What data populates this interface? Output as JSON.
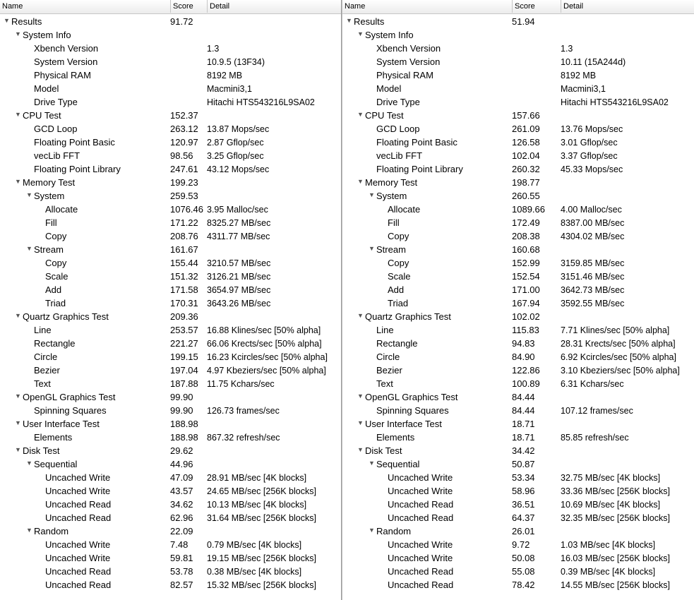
{
  "header": {
    "name": "Name",
    "score": "Score",
    "detail": "Detail"
  },
  "panels": [
    {
      "rows": [
        {
          "level": 0,
          "expander": true,
          "name": "Results",
          "score": "91.72",
          "detail": ""
        },
        {
          "level": 1,
          "expander": true,
          "name": "System Info",
          "score": "",
          "detail": ""
        },
        {
          "level": 2,
          "expander": false,
          "name": "Xbench Version",
          "score": "",
          "detail": "1.3"
        },
        {
          "level": 2,
          "expander": false,
          "name": "System Version",
          "score": "",
          "detail": "10.9.5 (13F34)"
        },
        {
          "level": 2,
          "expander": false,
          "name": "Physical RAM",
          "score": "",
          "detail": "8192 MB"
        },
        {
          "level": 2,
          "expander": false,
          "name": "Model",
          "score": "",
          "detail": "Macmini3,1"
        },
        {
          "level": 2,
          "expander": false,
          "name": "Drive Type",
          "score": "",
          "detail": "Hitachi HTS543216L9SA02"
        },
        {
          "level": 1,
          "expander": true,
          "name": "CPU Test",
          "score": "152.37",
          "detail": ""
        },
        {
          "level": 2,
          "expander": false,
          "name": "GCD Loop",
          "score": "263.12",
          "detail": "13.87 Mops/sec"
        },
        {
          "level": 2,
          "expander": false,
          "name": "Floating Point Basic",
          "score": "120.97",
          "detail": "2.87 Gflop/sec"
        },
        {
          "level": 2,
          "expander": false,
          "name": "vecLib FFT",
          "score": "98.56",
          "detail": "3.25 Gflop/sec"
        },
        {
          "level": 2,
          "expander": false,
          "name": "Floating Point Library",
          "score": "247.61",
          "detail": "43.12 Mops/sec"
        },
        {
          "level": 1,
          "expander": true,
          "name": "Memory Test",
          "score": "199.23",
          "detail": ""
        },
        {
          "level": 2,
          "expander": true,
          "name": "System",
          "score": "259.53",
          "detail": ""
        },
        {
          "level": 3,
          "expander": false,
          "name": "Allocate",
          "score": "1076.46",
          "detail": "3.95 Malloc/sec"
        },
        {
          "level": 3,
          "expander": false,
          "name": "Fill",
          "score": "171.22",
          "detail": "8325.27 MB/sec"
        },
        {
          "level": 3,
          "expander": false,
          "name": "Copy",
          "score": "208.76",
          "detail": "4311.77 MB/sec"
        },
        {
          "level": 2,
          "expander": true,
          "name": "Stream",
          "score": "161.67",
          "detail": ""
        },
        {
          "level": 3,
          "expander": false,
          "name": "Copy",
          "score": "155.44",
          "detail": "3210.57 MB/sec"
        },
        {
          "level": 3,
          "expander": false,
          "name": "Scale",
          "score": "151.32",
          "detail": "3126.21 MB/sec"
        },
        {
          "level": 3,
          "expander": false,
          "name": "Add",
          "score": "171.58",
          "detail": "3654.97 MB/sec"
        },
        {
          "level": 3,
          "expander": false,
          "name": "Triad",
          "score": "170.31",
          "detail": "3643.26 MB/sec"
        },
        {
          "level": 1,
          "expander": true,
          "name": "Quartz Graphics Test",
          "score": "209.36",
          "detail": ""
        },
        {
          "level": 2,
          "expander": false,
          "name": "Line",
          "score": "253.57",
          "detail": "16.88 Klines/sec [50% alpha]"
        },
        {
          "level": 2,
          "expander": false,
          "name": "Rectangle",
          "score": "221.27",
          "detail": "66.06 Krects/sec [50% alpha]"
        },
        {
          "level": 2,
          "expander": false,
          "name": "Circle",
          "score": "199.15",
          "detail": "16.23 Kcircles/sec [50% alpha]"
        },
        {
          "level": 2,
          "expander": false,
          "name": "Bezier",
          "score": "197.04",
          "detail": "4.97 Kbeziers/sec [50% alpha]"
        },
        {
          "level": 2,
          "expander": false,
          "name": "Text",
          "score": "187.88",
          "detail": "11.75 Kchars/sec"
        },
        {
          "level": 1,
          "expander": true,
          "name": "OpenGL Graphics Test",
          "score": "99.90",
          "detail": ""
        },
        {
          "level": 2,
          "expander": false,
          "name": "Spinning Squares",
          "score": "99.90",
          "detail": "126.73 frames/sec"
        },
        {
          "level": 1,
          "expander": true,
          "name": "User Interface Test",
          "score": "188.98",
          "detail": ""
        },
        {
          "level": 2,
          "expander": false,
          "name": "Elements",
          "score": "188.98",
          "detail": "867.32 refresh/sec"
        },
        {
          "level": 1,
          "expander": true,
          "name": "Disk Test",
          "score": "29.62",
          "detail": ""
        },
        {
          "level": 2,
          "expander": true,
          "name": "Sequential",
          "score": "44.96",
          "detail": ""
        },
        {
          "level": 3,
          "expander": false,
          "name": "Uncached Write",
          "score": "47.09",
          "detail": "28.91 MB/sec [4K blocks]"
        },
        {
          "level": 3,
          "expander": false,
          "name": "Uncached Write",
          "score": "43.57",
          "detail": "24.65 MB/sec [256K blocks]"
        },
        {
          "level": 3,
          "expander": false,
          "name": "Uncached Read",
          "score": "34.62",
          "detail": "10.13 MB/sec [4K blocks]"
        },
        {
          "level": 3,
          "expander": false,
          "name": "Uncached Read",
          "score": "62.96",
          "detail": "31.64 MB/sec [256K blocks]"
        },
        {
          "level": 2,
          "expander": true,
          "name": "Random",
          "score": "22.09",
          "detail": ""
        },
        {
          "level": 3,
          "expander": false,
          "name": "Uncached Write",
          "score": "7.48",
          "detail": "0.79 MB/sec [4K blocks]"
        },
        {
          "level": 3,
          "expander": false,
          "name": "Uncached Write",
          "score": "59.81",
          "detail": "19.15 MB/sec [256K blocks]"
        },
        {
          "level": 3,
          "expander": false,
          "name": "Uncached Read",
          "score": "53.78",
          "detail": "0.38 MB/sec [4K blocks]"
        },
        {
          "level": 3,
          "expander": false,
          "name": "Uncached Read",
          "score": "82.57",
          "detail": "15.32 MB/sec [256K blocks]"
        }
      ]
    },
    {
      "rows": [
        {
          "level": 0,
          "expander": true,
          "name": "Results",
          "score": "51.94",
          "detail": ""
        },
        {
          "level": 1,
          "expander": true,
          "name": "System Info",
          "score": "",
          "detail": ""
        },
        {
          "level": 2,
          "expander": false,
          "name": "Xbench Version",
          "score": "",
          "detail": "1.3"
        },
        {
          "level": 2,
          "expander": false,
          "name": "System Version",
          "score": "",
          "detail": "10.11 (15A244d)"
        },
        {
          "level": 2,
          "expander": false,
          "name": "Physical RAM",
          "score": "",
          "detail": "8192 MB"
        },
        {
          "level": 2,
          "expander": false,
          "name": "Model",
          "score": "",
          "detail": "Macmini3,1"
        },
        {
          "level": 2,
          "expander": false,
          "name": "Drive Type",
          "score": "",
          "detail": "Hitachi HTS543216L9SA02"
        },
        {
          "level": 1,
          "expander": true,
          "name": "CPU Test",
          "score": "157.66",
          "detail": ""
        },
        {
          "level": 2,
          "expander": false,
          "name": "GCD Loop",
          "score": "261.09",
          "detail": "13.76 Mops/sec"
        },
        {
          "level": 2,
          "expander": false,
          "name": "Floating Point Basic",
          "score": "126.58",
          "detail": "3.01 Gflop/sec"
        },
        {
          "level": 2,
          "expander": false,
          "name": "vecLib FFT",
          "score": "102.04",
          "detail": "3.37 Gflop/sec"
        },
        {
          "level": 2,
          "expander": false,
          "name": "Floating Point Library",
          "score": "260.32",
          "detail": "45.33 Mops/sec"
        },
        {
          "level": 1,
          "expander": true,
          "name": "Memory Test",
          "score": "198.77",
          "detail": ""
        },
        {
          "level": 2,
          "expander": true,
          "name": "System",
          "score": "260.55",
          "detail": ""
        },
        {
          "level": 3,
          "expander": false,
          "name": "Allocate",
          "score": "1089.66",
          "detail": "4.00 Malloc/sec"
        },
        {
          "level": 3,
          "expander": false,
          "name": "Fill",
          "score": "172.49",
          "detail": "8387.00 MB/sec"
        },
        {
          "level": 3,
          "expander": false,
          "name": "Copy",
          "score": "208.38",
          "detail": "4304.02 MB/sec"
        },
        {
          "level": 2,
          "expander": true,
          "name": "Stream",
          "score": "160.68",
          "detail": ""
        },
        {
          "level": 3,
          "expander": false,
          "name": "Copy",
          "score": "152.99",
          "detail": "3159.85 MB/sec"
        },
        {
          "level": 3,
          "expander": false,
          "name": "Scale",
          "score": "152.54",
          "detail": "3151.46 MB/sec"
        },
        {
          "level": 3,
          "expander": false,
          "name": "Add",
          "score": "171.00",
          "detail": "3642.73 MB/sec"
        },
        {
          "level": 3,
          "expander": false,
          "name": "Triad",
          "score": "167.94",
          "detail": "3592.55 MB/sec"
        },
        {
          "level": 1,
          "expander": true,
          "name": "Quartz Graphics Test",
          "score": "102.02",
          "detail": ""
        },
        {
          "level": 2,
          "expander": false,
          "name": "Line",
          "score": "115.83",
          "detail": "7.71 Klines/sec [50% alpha]"
        },
        {
          "level": 2,
          "expander": false,
          "name": "Rectangle",
          "score": "94.83",
          "detail": "28.31 Krects/sec [50% alpha]"
        },
        {
          "level": 2,
          "expander": false,
          "name": "Circle",
          "score": "84.90",
          "detail": "6.92 Kcircles/sec [50% alpha]"
        },
        {
          "level": 2,
          "expander": false,
          "name": "Bezier",
          "score": "122.86",
          "detail": "3.10 Kbeziers/sec [50% alpha]"
        },
        {
          "level": 2,
          "expander": false,
          "name": "Text",
          "score": "100.89",
          "detail": "6.31 Kchars/sec"
        },
        {
          "level": 1,
          "expander": true,
          "name": "OpenGL Graphics Test",
          "score": "84.44",
          "detail": ""
        },
        {
          "level": 2,
          "expander": false,
          "name": "Spinning Squares",
          "score": "84.44",
          "detail": "107.12 frames/sec"
        },
        {
          "level": 1,
          "expander": true,
          "name": "User Interface Test",
          "score": "18.71",
          "detail": ""
        },
        {
          "level": 2,
          "expander": false,
          "name": "Elements",
          "score": "18.71",
          "detail": "85.85 refresh/sec"
        },
        {
          "level": 1,
          "expander": true,
          "name": "Disk Test",
          "score": "34.42",
          "detail": ""
        },
        {
          "level": 2,
          "expander": true,
          "name": "Sequential",
          "score": "50.87",
          "detail": ""
        },
        {
          "level": 3,
          "expander": false,
          "name": "Uncached Write",
          "score": "53.34",
          "detail": "32.75 MB/sec [4K blocks]"
        },
        {
          "level": 3,
          "expander": false,
          "name": "Uncached Write",
          "score": "58.96",
          "detail": "33.36 MB/sec [256K blocks]"
        },
        {
          "level": 3,
          "expander": false,
          "name": "Uncached Read",
          "score": "36.51",
          "detail": "10.69 MB/sec [4K blocks]"
        },
        {
          "level": 3,
          "expander": false,
          "name": "Uncached Read",
          "score": "64.37",
          "detail": "32.35 MB/sec [256K blocks]"
        },
        {
          "level": 2,
          "expander": true,
          "name": "Random",
          "score": "26.01",
          "detail": ""
        },
        {
          "level": 3,
          "expander": false,
          "name": "Uncached Write",
          "score": "9.72",
          "detail": "1.03 MB/sec [4K blocks]"
        },
        {
          "level": 3,
          "expander": false,
          "name": "Uncached Write",
          "score": "50.08",
          "detail": "16.03 MB/sec [256K blocks]"
        },
        {
          "level": 3,
          "expander": false,
          "name": "Uncached Read",
          "score": "55.08",
          "detail": "0.39 MB/sec [4K blocks]"
        },
        {
          "level": 3,
          "expander": false,
          "name": "Uncached Read",
          "score": "78.42",
          "detail": "14.55 MB/sec [256K blocks]"
        }
      ]
    }
  ],
  "icons": {
    "expanded": "disclosure-triangle-down-icon"
  }
}
